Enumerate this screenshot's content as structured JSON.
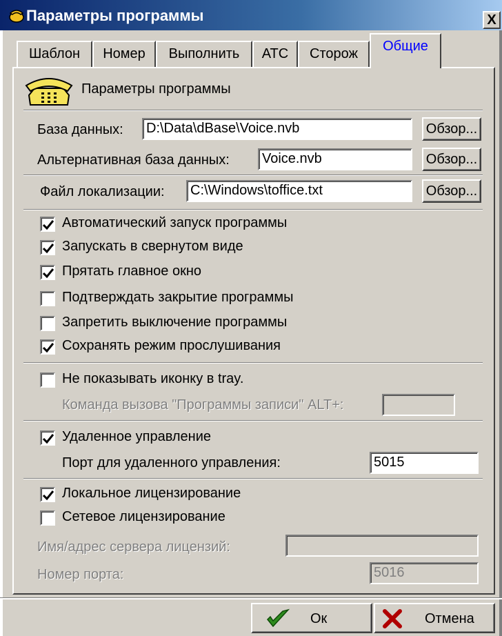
{
  "window": {
    "title": "Параметры программы",
    "close_label": "X"
  },
  "tabs": [
    {
      "label": "Шаблон"
    },
    {
      "label": "Номер"
    },
    {
      "label": "Выполнить"
    },
    {
      "label": "АТС"
    },
    {
      "label": "Сторож"
    },
    {
      "label": "Общие",
      "active": true
    }
  ],
  "panel": {
    "header_title": "Параметры программы",
    "database": {
      "label": "База данных:",
      "value": "D:\\Data\\dBase\\Voice.nvb",
      "browse": "Обзор..."
    },
    "alt_database": {
      "label": "Альтернативная база данных:",
      "value": "Voice.nvb",
      "browse": "Обзор..."
    },
    "localization": {
      "label": "Файл локализации:",
      "value": "C:\\Windows\\toffice.txt",
      "browse": "Обзор..."
    },
    "options": [
      {
        "label": "Автоматический запуск программы",
        "checked": true
      },
      {
        "label": "Запускать в свернутом виде",
        "checked": true
      },
      {
        "label": "Прятать главное окно",
        "checked": true
      },
      {
        "label": "Подтверждать закрытие программы",
        "checked": false
      },
      {
        "label": "Запретить выключение программы",
        "checked": false
      },
      {
        "label": "Сохранять режим прослушивания",
        "checked": true
      }
    ],
    "tray": {
      "label": "Не показывать иконку в tray.",
      "checked": false,
      "hotkey_label": "Команда вызова \"Программы записи\" ALT+:",
      "hotkey_value": ""
    },
    "remote": {
      "label": "Удаленное управление",
      "checked": true,
      "port_label": "Порт для удаленного управления:",
      "port_value": "5015"
    },
    "licensing": {
      "local_label": "Локальное лицензирование",
      "local_checked": true,
      "network_label": "Сетевое лицензирование",
      "network_checked": false,
      "server_label": "Имя/адрес сервера лицензий:",
      "server_value": "",
      "port_label": "Номер порта:",
      "port_value": "5016"
    }
  },
  "buttons": {
    "ok": "Ок",
    "cancel": "Отмена"
  },
  "colors": {
    "title_start": "#0a246a",
    "title_end": "#a6caf0",
    "face": "#d4d0c8",
    "active_tab_text": "#0000ff",
    "ok_check": "#2e8b1e",
    "cancel_x": "#b00000"
  }
}
